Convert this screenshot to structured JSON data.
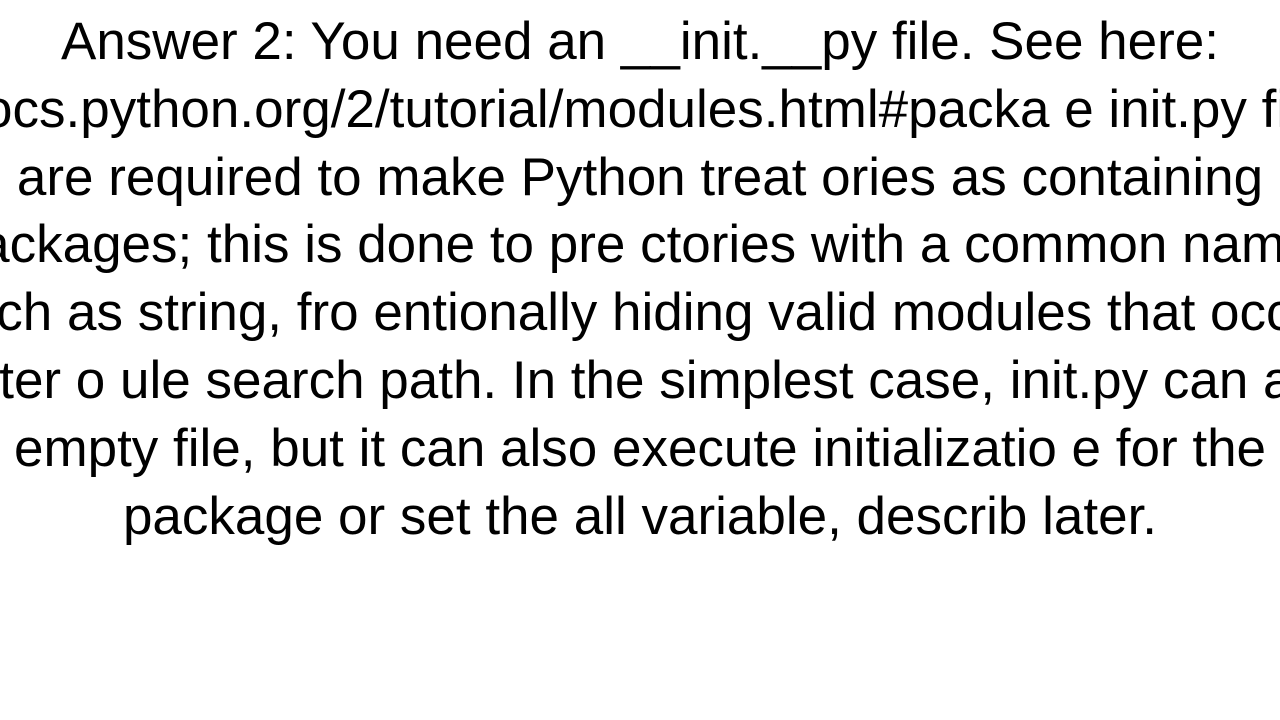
{
  "document": {
    "body_text": "Answer 2: You need an __init.__py file. See here: //docs.python.org/2/tutorial/modules.html#packa e init.py files are required to make Python treat ories as containing packages; this is done to pre ctories with a common name, such as string, fro entionally hiding valid modules that occur later o ule search path. In the simplest case, init.py can an empty file, but it can also execute initializatio e for the package or set the all variable, describ later."
  }
}
